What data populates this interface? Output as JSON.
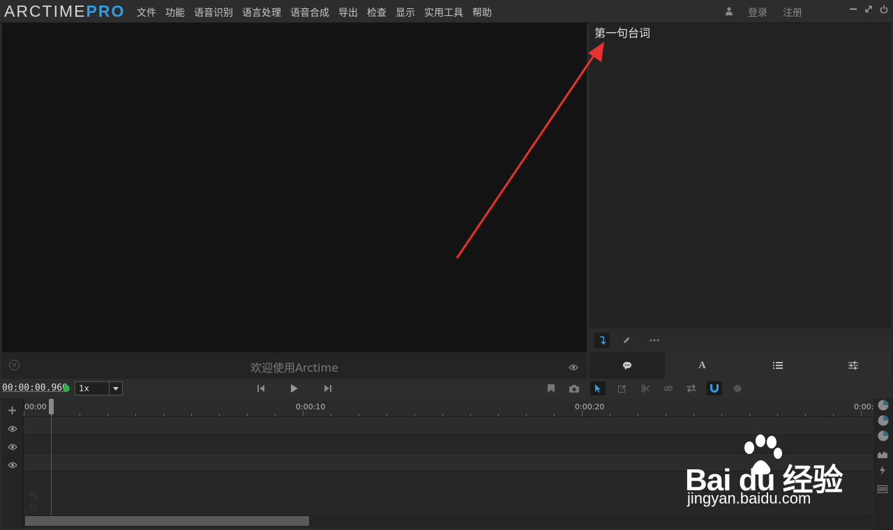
{
  "app": {
    "brand": "ARCTIME",
    "brand_suffix": "PRO",
    "menu": [
      "文件",
      "功能",
      "语音识别",
      "语言处理",
      "语音合成",
      "导出",
      "检查",
      "显示",
      "实用工具",
      "帮助"
    ],
    "login": "登录",
    "register": "注册"
  },
  "video": {
    "welcome": "欢迎使用Arctime",
    "badge": "V"
  },
  "subtitle_panel": {
    "first_line": "第一句台词"
  },
  "transport": {
    "timecode": "00:00:00.960",
    "speed": "1x"
  },
  "timeline": {
    "ruler_labels": [
      "00:00",
      "0:00:10",
      "0:00:20",
      "0:00:"
    ],
    "faint_labels": [
      "T0",
      "S1"
    ]
  },
  "watermark": {
    "logo_text": "Bai du 经验",
    "url": "jingyan.baidu.com"
  },
  "colors": {
    "accent": "#2f9ee6",
    "status_green": "#2bb44a",
    "playhead": "#e02020",
    "arrow": "#e8322f"
  }
}
